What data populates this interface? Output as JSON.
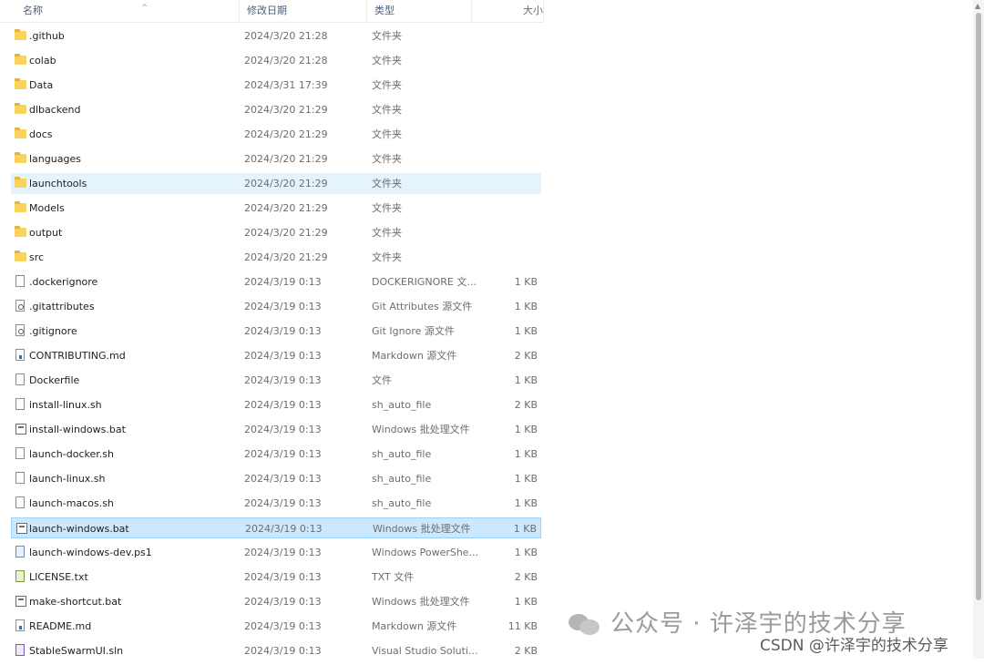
{
  "columns": {
    "name": "名称",
    "date": "修改日期",
    "type": "类型",
    "size": "大小"
  },
  "files": [
    {
      "name": ".github",
      "date": "2024/3/20 21:28",
      "type": "文件夹",
      "size": "",
      "icon": "folder-icon"
    },
    {
      "name": "colab",
      "date": "2024/3/20 21:28",
      "type": "文件夹",
      "size": "",
      "icon": "folder-icon"
    },
    {
      "name": "Data",
      "date": "2024/3/31 17:39",
      "type": "文件夹",
      "size": "",
      "icon": "folder-icon"
    },
    {
      "name": "dlbackend",
      "date": "2024/3/20 21:29",
      "type": "文件夹",
      "size": "",
      "icon": "folder-icon"
    },
    {
      "name": "docs",
      "date": "2024/3/20 21:29",
      "type": "文件夹",
      "size": "",
      "icon": "folder-icon"
    },
    {
      "name": "languages",
      "date": "2024/3/20 21:29",
      "type": "文件夹",
      "size": "",
      "icon": "folder-icon"
    },
    {
      "name": "launchtools",
      "date": "2024/3/20 21:29",
      "type": "文件夹",
      "size": "",
      "icon": "folder-icon",
      "state": "hover"
    },
    {
      "name": "Models",
      "date": "2024/3/20 21:29",
      "type": "文件夹",
      "size": "",
      "icon": "folder-icon"
    },
    {
      "name": "output",
      "date": "2024/3/20 21:29",
      "type": "文件夹",
      "size": "",
      "icon": "folder-icon"
    },
    {
      "name": "src",
      "date": "2024/3/20 21:29",
      "type": "文件夹",
      "size": "",
      "icon": "folder-icon"
    },
    {
      "name": ".dockerignore",
      "date": "2024/3/19 0:13",
      "type": "DOCKERIGNORE 文...",
      "size": "1 KB",
      "icon": "file-icon"
    },
    {
      "name": ".gitattributes",
      "date": "2024/3/19 0:13",
      "type": "Git Attributes 源文件",
      "size": "1 KB",
      "icon": "gear-file-icon"
    },
    {
      "name": ".gitignore",
      "date": "2024/3/19 0:13",
      "type": "Git Ignore 源文件",
      "size": "1 KB",
      "icon": "gear-file-icon"
    },
    {
      "name": "CONTRIBUTING.md",
      "date": "2024/3/19 0:13",
      "type": "Markdown 源文件",
      "size": "2 KB",
      "icon": "markdown-file-icon"
    },
    {
      "name": "Dockerfile",
      "date": "2024/3/19 0:13",
      "type": "文件",
      "size": "1 KB",
      "icon": "file-icon"
    },
    {
      "name": "install-linux.sh",
      "date": "2024/3/19 0:13",
      "type": "sh_auto_file",
      "size": "2 KB",
      "icon": "file-icon"
    },
    {
      "name": "install-windows.bat",
      "date": "2024/3/19 0:13",
      "type": "Windows 批处理文件",
      "size": "1 KB",
      "icon": "batch-file-icon"
    },
    {
      "name": "launch-docker.sh",
      "date": "2024/3/19 0:13",
      "type": "sh_auto_file",
      "size": "1 KB",
      "icon": "file-icon"
    },
    {
      "name": "launch-linux.sh",
      "date": "2024/3/19 0:13",
      "type": "sh_auto_file",
      "size": "1 KB",
      "icon": "file-icon"
    },
    {
      "name": "launch-macos.sh",
      "date": "2024/3/19 0:13",
      "type": "sh_auto_file",
      "size": "1 KB",
      "icon": "file-icon"
    },
    {
      "name": "launch-windows.bat",
      "date": "2024/3/19 0:13",
      "type": "Windows 批处理文件",
      "size": "1 KB",
      "icon": "batch-file-icon",
      "state": "selected"
    },
    {
      "name": "launch-windows-dev.ps1",
      "date": "2024/3/19 0:13",
      "type": "Windows PowerShe...",
      "size": "1 KB",
      "icon": "powershell-file-icon"
    },
    {
      "name": "LICENSE.txt",
      "date": "2024/3/19 0:13",
      "type": "TXT 文件",
      "size": "2 KB",
      "icon": "text-file-icon"
    },
    {
      "name": "make-shortcut.bat",
      "date": "2024/3/19 0:13",
      "type": "Windows 批处理文件",
      "size": "1 KB",
      "icon": "batch-file-icon"
    },
    {
      "name": "README.md",
      "date": "2024/3/19 0:13",
      "type": "Markdown 源文件",
      "size": "11 KB",
      "icon": "markdown-file-icon"
    },
    {
      "name": "StableSwarmUI.sln",
      "date": "2024/3/19 0:13",
      "type": "Visual Studio Soluti...",
      "size": "2 KB",
      "icon": "solution-file-icon"
    }
  ],
  "watermark": {
    "wechat": "公众号 · 许泽宇的技术分享",
    "csdn": "CSDN @许泽宇的技术分享"
  }
}
